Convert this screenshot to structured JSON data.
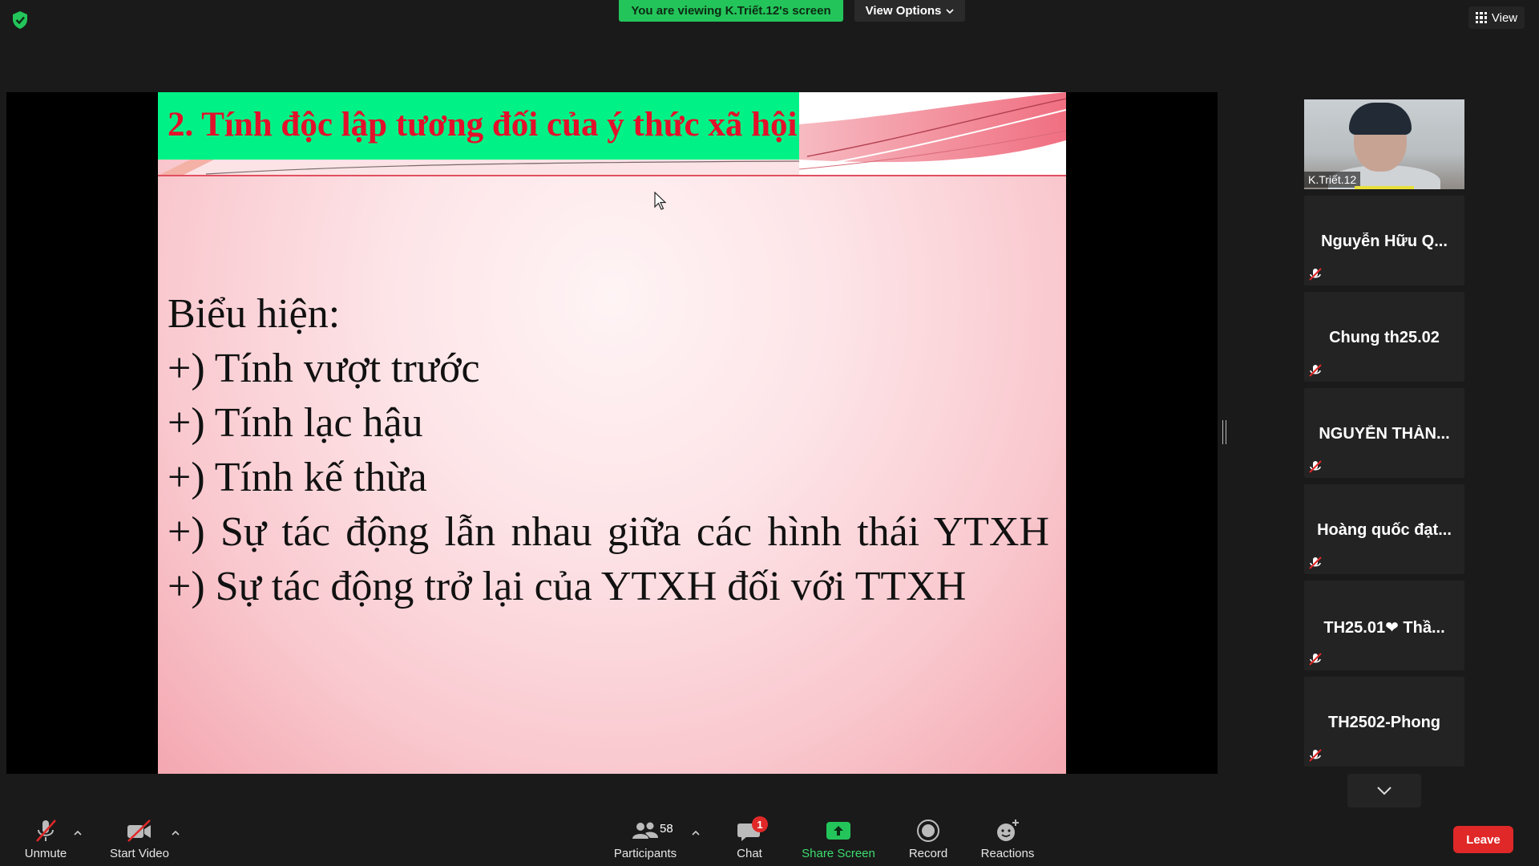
{
  "top_bar": {
    "viewing_banner": "You are viewing K.Triết.12's screen",
    "view_options_label": "View Options",
    "view_label": "View"
  },
  "slide": {
    "title": "2. Tính độc lập tương đối của ý thức xã hội",
    "lines": [
      "Biểu hiện:",
      "+) Tính vượt trước",
      "+) Tính lạc hậu",
      "+) Tính kế thừa",
      "+) Sự tác động lẫn nhau giữa các hình thái YTXH",
      "+) Sự tác động trở lại của YTXH đối với TTXH"
    ]
  },
  "participants_strip": {
    "video_tile_name": "K.Triết.12",
    "tiles": [
      {
        "name": "Nguyễn Hữu Q..."
      },
      {
        "name": "Chung th25.02"
      },
      {
        "name": "NGUYỄN THÀN..."
      },
      {
        "name": "Hoàng quốc đạt..."
      },
      {
        "name": "TH25.01❤ Thầ..."
      },
      {
        "name": "TH2502-Phong"
      }
    ]
  },
  "toolbar": {
    "unmute_label": "Unmute",
    "start_video_label": "Start Video",
    "participants_label": "Participants",
    "participants_count": "58",
    "chat_label": "Chat",
    "chat_badge": "1",
    "share_screen_label": "Share Screen",
    "record_label": "Record",
    "reactions_label": "Reactions",
    "leave_label": "Leave"
  },
  "colors": {
    "share_green": "#23c55a",
    "leave_red": "#e02828",
    "slide_title_red": "#e3102a",
    "slide_header_green": "#00f286"
  }
}
